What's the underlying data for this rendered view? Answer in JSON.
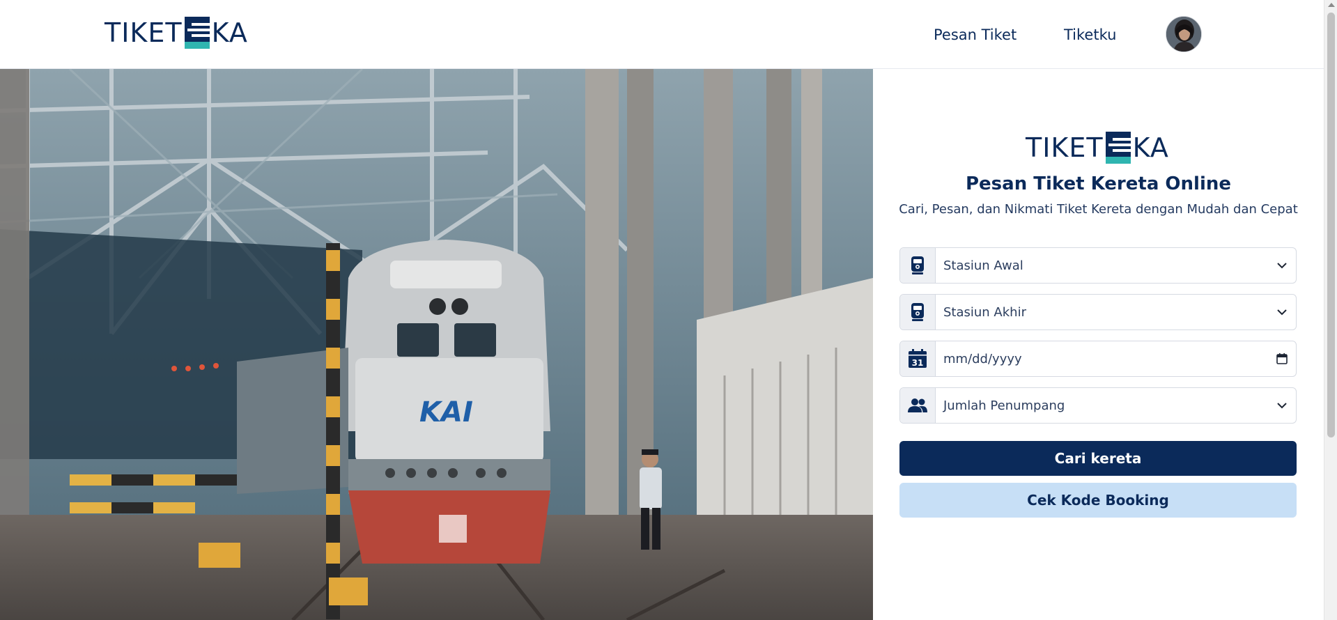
{
  "header": {
    "logo": {
      "left": "TIKET",
      "right": "KA"
    },
    "nav": [
      {
        "label": "Pesan Tiket"
      },
      {
        "label": "Tiketku"
      }
    ]
  },
  "hero": {
    "locomotive_text": "KAI"
  },
  "panel": {
    "logo": {
      "left": "TIKET",
      "right": "KA"
    },
    "title": "Pesan Tiket Kereta Online",
    "subtitle": "Cari, Pesan, dan Nikmati Tiket Kereta dengan Mudah dan Cepat",
    "fields": [
      {
        "label": "Stasiun Awal",
        "icon": "train-icon"
      },
      {
        "label": "Stasiun Akhir",
        "icon": "train-icon"
      },
      {
        "label": "mm/dd/yyyy",
        "icon": "calendar-icon",
        "calendar_day": "31"
      },
      {
        "label": "Jumlah Penumpang",
        "icon": "users-icon"
      }
    ],
    "primary_button": "Cari kereta",
    "secondary_button": "Cek Kode Booking"
  },
  "colors": {
    "brand_navy": "#0b2a5a",
    "brand_teal": "#2fb5b0",
    "secondary_button_bg": "#c7dff6"
  }
}
